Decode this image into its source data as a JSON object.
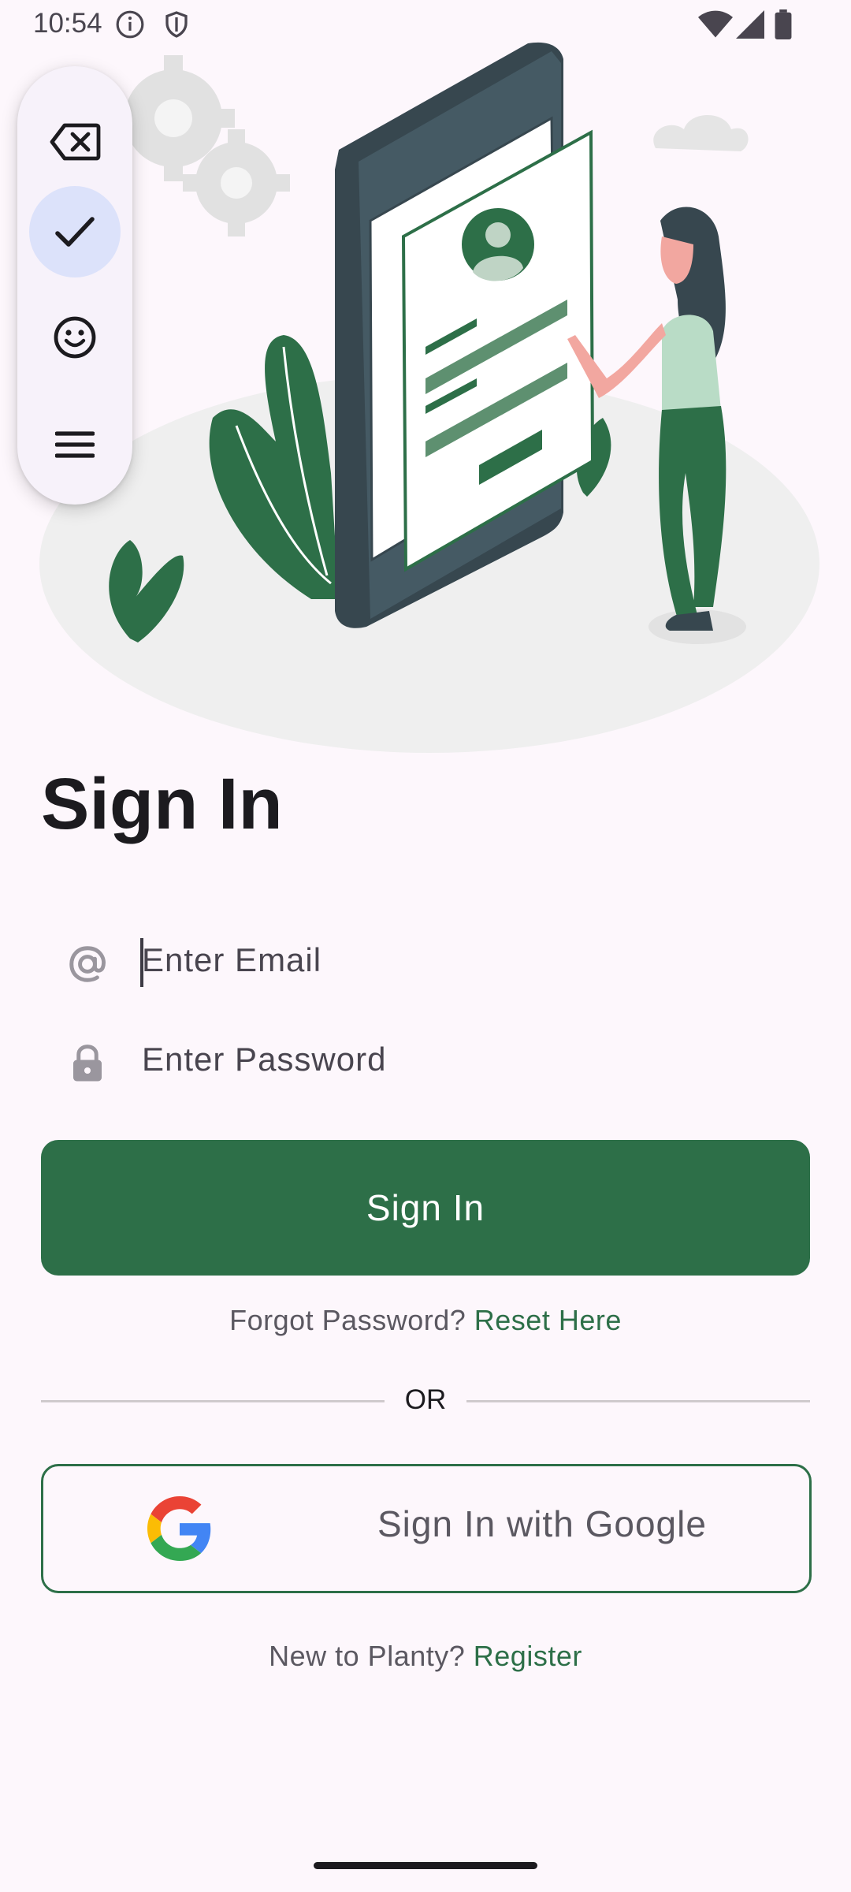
{
  "status_bar": {
    "time": "10:54"
  },
  "keyboard_toolbar": {
    "items": [
      "backspace-icon",
      "check-icon",
      "emoji-icon",
      "menu-icon"
    ],
    "active_item": "check-icon"
  },
  "title": "Sign In",
  "email_field": {
    "placeholder": "Enter Email",
    "icon": "at-icon"
  },
  "password_field": {
    "placeholder": "Enter Password",
    "icon": "lock-icon"
  },
  "sign_in_button": {
    "label": "Sign In"
  },
  "forgot": {
    "text": "Forgot Password?",
    "link": "Reset Here"
  },
  "divider_label": "OR",
  "google_button": {
    "label": "Sign In with Google",
    "icon": "google-icon"
  },
  "register": {
    "text": "New to Planty?",
    "link": "Register"
  },
  "colors": {
    "primary": "#2D6F48",
    "background": "#FDF7FC",
    "toolbar_bg": "#F7F2FA",
    "toolbar_active": "#DCE2FA"
  }
}
